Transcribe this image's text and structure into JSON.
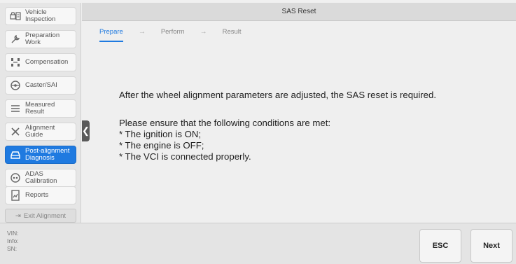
{
  "sidebar": {
    "items": [
      {
        "label": "Vehicle\nInspection",
        "icon": "car-inspection-icon"
      },
      {
        "label": "Preparation\nWork",
        "icon": "wrench-icon"
      },
      {
        "label": "Compensation",
        "icon": "compensation-icon"
      },
      {
        "label": "Caster/SAI",
        "icon": "steering-wheel-icon"
      },
      {
        "label": "Measured\nResult",
        "icon": "list-icon"
      },
      {
        "label": "Alignment\nGuide",
        "icon": "tools-icon"
      },
      {
        "label": "Post-alignment\nDiagnosis",
        "icon": "car-icon",
        "active": true
      },
      {
        "label": "ADAS\nCalibration",
        "icon": "adas-icon"
      },
      {
        "label": "Reports",
        "icon": "report-icon"
      }
    ],
    "exit_label": "Exit Alignment"
  },
  "main": {
    "title": "SAS Reset",
    "steps": [
      "Prepare",
      "Perform",
      "Result"
    ],
    "active_step": "Prepare",
    "message": "After the wheel alignment parameters are adjusted, the SAS reset is required.",
    "conditions_intro": "Please ensure that the following conditions are met:",
    "conditions": [
      "* The ignition is ON;",
      "* The engine is OFF;",
      "* The VCI is connected properly."
    ]
  },
  "footer": {
    "vin_label": "VIN:",
    "info_label": "Info:",
    "sn_label": "SN:",
    "esc_label": "ESC",
    "next_label": "Next"
  },
  "colors": {
    "accent": "#1f7ae0"
  }
}
